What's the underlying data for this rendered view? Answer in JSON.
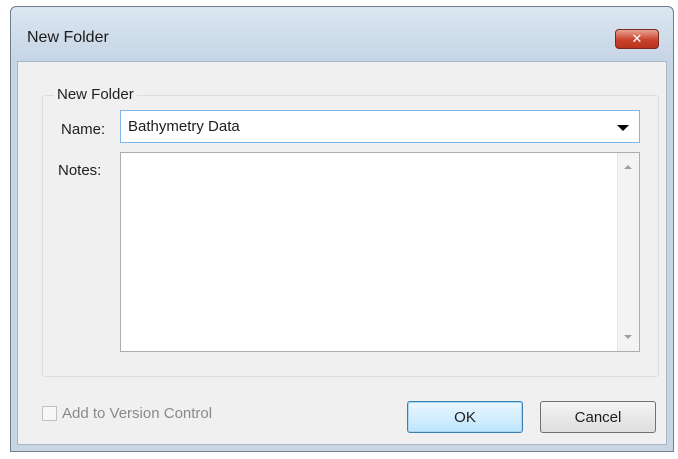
{
  "window": {
    "title": "New Folder",
    "close_label": "✕"
  },
  "group": {
    "legend": "New Folder",
    "name_label": "Name:",
    "name_value": "Bathymetry Data",
    "notes_label": "Notes:",
    "notes_value": ""
  },
  "options": {
    "version_control_label": "Add to Version Control",
    "version_control_checked": false,
    "version_control_enabled": false
  },
  "buttons": {
    "ok_label": "OK",
    "cancel_label": "Cancel"
  },
  "colors": {
    "title_bar": "#c6d5e5",
    "close_button": "#c9432c",
    "focus_border": "#7eb4ea",
    "dialog_face": "#f0f0f0"
  },
  "icons": {
    "close": "close-icon",
    "combo_dropdown": "chevron-down-icon",
    "scroll_up": "scroll-up-arrow-icon",
    "scroll_down": "scroll-down-arrow-icon"
  }
}
